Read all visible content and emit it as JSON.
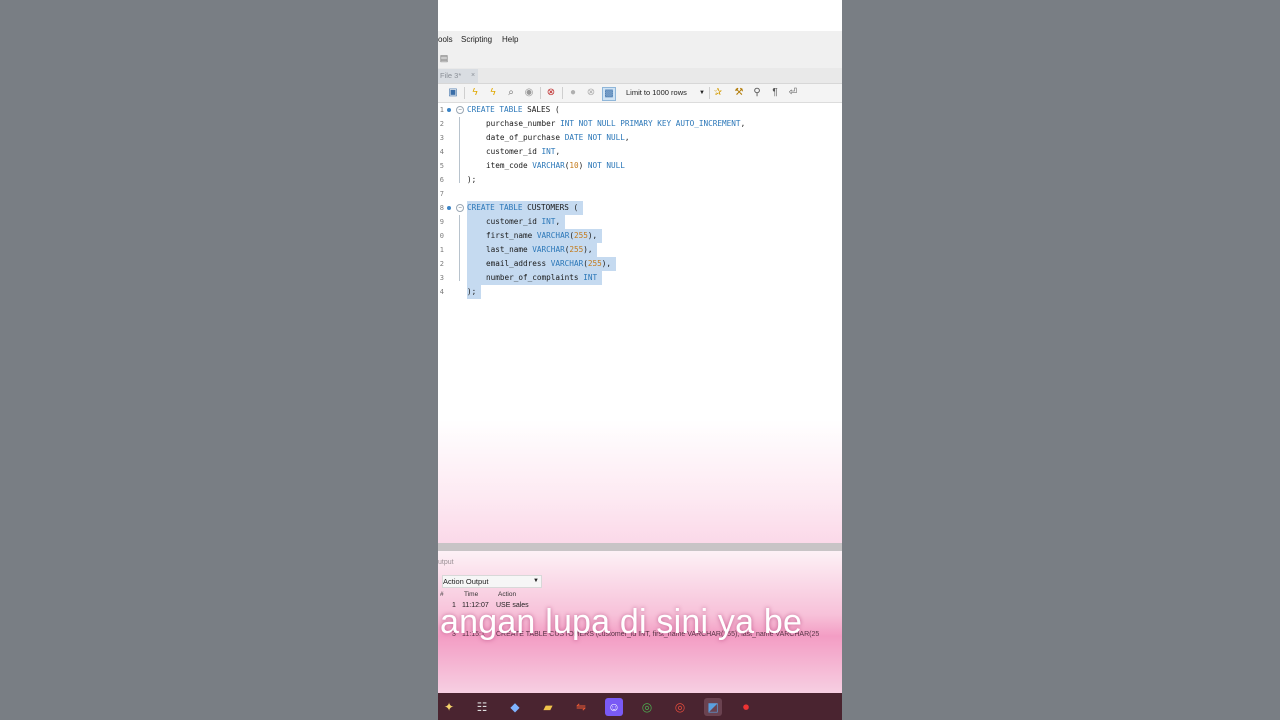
{
  "menu": [
    "ools",
    "Scripting",
    "Help"
  ],
  "tab": {
    "label": "File 3*",
    "close": "×"
  },
  "toolbar": {
    "limit_value": "Limit to 1000 rows",
    "icons": [
      "save-icon",
      "execute-icon",
      "execute-current-icon",
      "explain-icon",
      "stop-icon",
      "find-icon",
      "commit-icon",
      "rollback-icon",
      "autocommit-icon",
      "beautify-icon",
      "wrench-icon",
      "search-icon",
      "invisible-chars-icon",
      "word-wrap-icon"
    ]
  },
  "editor": {
    "lines": [
      {
        "n": "1",
        "dot": true,
        "fold": true,
        "sel": false,
        "tokens": [
          [
            "kw",
            "CREATE TABLE "
          ],
          [
            "",
            "SALES ("
          ]
        ]
      },
      {
        "n": "2",
        "indent": true,
        "sel": false,
        "tokens": [
          [
            "",
            "purchase_number "
          ],
          [
            "kw",
            "INT NOT NULL PRIMARY KEY AUTO_INCREMENT"
          ],
          [
            "",
            ","
          ]
        ]
      },
      {
        "n": "3",
        "indent": true,
        "sel": false,
        "tokens": [
          [
            "",
            "date_of_purchase "
          ],
          [
            "kw",
            "DATE NOT NULL"
          ],
          [
            "",
            ","
          ]
        ]
      },
      {
        "n": "4",
        "indent": true,
        "sel": false,
        "tokens": [
          [
            "",
            "customer_id "
          ],
          [
            "kw",
            "INT"
          ],
          [
            "",
            ","
          ]
        ]
      },
      {
        "n": "5",
        "indent": true,
        "sel": false,
        "tokens": [
          [
            "",
            "item_code "
          ],
          [
            "kw",
            "VARCHAR"
          ],
          [
            "",
            "("
          ],
          [
            "num",
            "10"
          ],
          [
            "",
            ") "
          ],
          [
            "kw",
            "NOT NULL"
          ]
        ]
      },
      {
        "n": "6",
        "sel": false,
        "tokens": [
          [
            "",
            ");"
          ]
        ]
      },
      {
        "n": "7",
        "sel": false,
        "tokens": []
      },
      {
        "n": "8",
        "dot": true,
        "fold": true,
        "sel": true,
        "tokens": [
          [
            "kw",
            "CREATE TABLE "
          ],
          [
            "",
            "CUSTOMERS ("
          ]
        ]
      },
      {
        "n": "9",
        "indent": true,
        "sel": true,
        "tokens": [
          [
            "",
            "customer_id "
          ],
          [
            "kw",
            "INT"
          ],
          [
            "",
            ","
          ]
        ]
      },
      {
        "n": "0",
        "indent": true,
        "sel": true,
        "tokens": [
          [
            "",
            "first_name "
          ],
          [
            "kw",
            "VARCHAR"
          ],
          [
            "",
            "("
          ],
          [
            "num",
            "255"
          ],
          [
            "",
            "),"
          ]
        ]
      },
      {
        "n": "1",
        "indent": true,
        "sel": true,
        "tokens": [
          [
            "",
            "last_name "
          ],
          [
            "kw",
            "VARCHAR"
          ],
          [
            "",
            "("
          ],
          [
            "num",
            "255"
          ],
          [
            "",
            "),"
          ]
        ]
      },
      {
        "n": "2",
        "indent": true,
        "sel": true,
        "tokens": [
          [
            "",
            "email_address "
          ],
          [
            "kw",
            "VARCHAR"
          ],
          [
            "",
            "("
          ],
          [
            "num",
            "255"
          ],
          [
            "",
            "),"
          ]
        ]
      },
      {
        "n": "3",
        "indent": true,
        "sel": true,
        "tokens": [
          [
            "",
            "number_of_complaints "
          ],
          [
            "kw",
            "INT"
          ]
        ]
      },
      {
        "n": "4",
        "sel": true,
        "tokens": [
          [
            "",
            ");"
          ]
        ]
      }
    ]
  },
  "output": {
    "header": "utput",
    "selector": "Action Output",
    "columns": [
      "#",
      "Time",
      "Action"
    ],
    "rows": [
      {
        "num": "1",
        "time": "11:12:07",
        "action": "USE sales"
      },
      {
        "num": "3",
        "time": "11:15:1",
        "action": "CREATE TABLE CUSTOMERS (customer_id INT,   first_name VARCHAR(255),   last_name VARCHAR(25"
      }
    ]
  },
  "caption": "angan lupa di sini ya be",
  "taskbar": [
    "copilot-icon",
    "task-view-icon",
    "microsoft365-icon",
    "file-explorer-icon",
    "git-icon",
    "discord-icon",
    "chrome-icon",
    "chrome-alt-icon",
    "mysql-workbench-icon",
    "recorder-icon"
  ]
}
